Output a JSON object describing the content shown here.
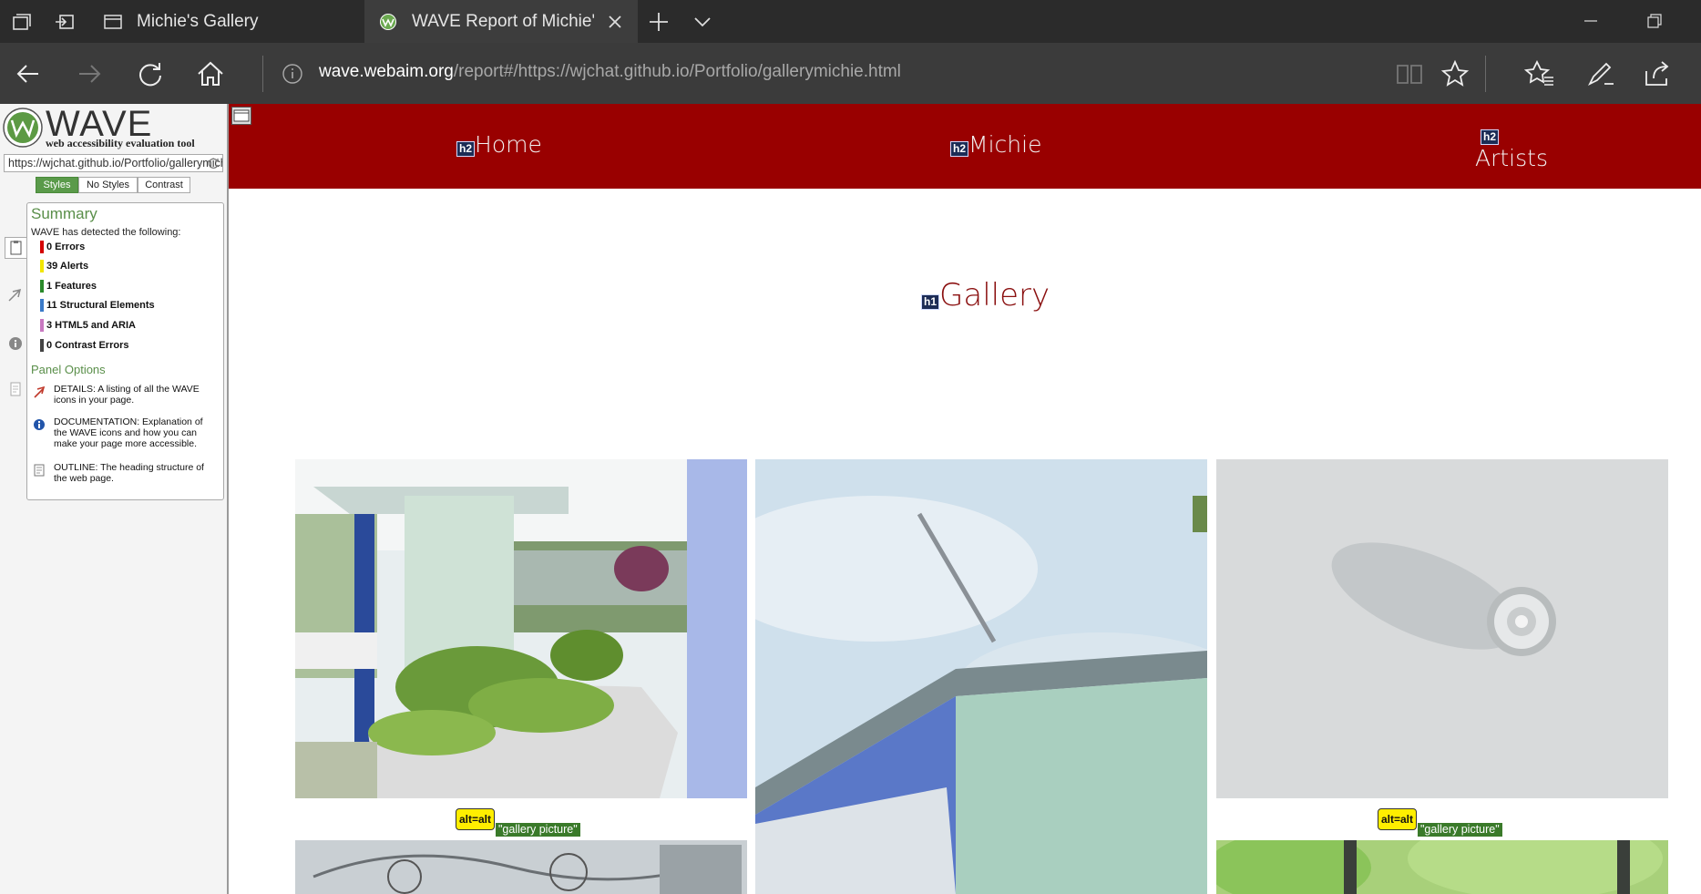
{
  "browser": {
    "tabs": [
      {
        "label": "Michie's Gallery",
        "active": false
      },
      {
        "label": "WAVE Report of Michie'",
        "active": true
      }
    ],
    "url_host": "wave.webaim.org",
    "url_path": "/report#/https://wjchat.github.io/Portfolio/gallerymichie.html"
  },
  "wave": {
    "title": "WAVE",
    "subtitle": "web accessibility evaluation tool",
    "url_field": "https://wjchat.github.io/Portfolio/gallerymichie.html",
    "modes": [
      "Styles",
      "No Styles",
      "Contrast"
    ],
    "summary": {
      "title": "Summary",
      "detected": "WAVE has detected the following:",
      "categories": [
        {
          "label": "0 Errors",
          "color": "#d40000"
        },
        {
          "label": "39 Alerts",
          "color": "#f2e600"
        },
        {
          "label": "1 Features",
          "color": "#2a8a2a"
        },
        {
          "label": "11 Structural Elements",
          "color": "#3a7ac8"
        },
        {
          "label": "3 HTML5 and ARIA",
          "color": "#c878c0"
        },
        {
          "label": "0 Contrast Errors",
          "color": "#444444"
        }
      ]
    },
    "panel_options": {
      "title": "Panel Options",
      "items": [
        {
          "icon": "flag-icon",
          "text": "DETAILS: A listing of all the WAVE icons in your page."
        },
        {
          "icon": "info-icon",
          "text": "DOCUMENTATION: Explanation of the WAVE icons and how you can make your page more accessible."
        },
        {
          "icon": "document-icon",
          "text": "OUTLINE: The heading structure of the web page."
        }
      ]
    }
  },
  "page": {
    "nav": [
      {
        "tag": "h2",
        "label": "Home"
      },
      {
        "tag": "h2",
        "label": "Michie"
      },
      {
        "tag": "h2",
        "label": "Artists"
      }
    ],
    "heading": {
      "tag": "h1",
      "label": "Gallery"
    },
    "images": [
      {
        "alt_badge": "alt=alt",
        "alt_text": "\"gallery picture\""
      },
      {
        "alt_badge": "alt=alt",
        "alt_text": "\"gallery picture\""
      }
    ],
    "colors": {
      "nav_bg": "#990000",
      "heading": "#8a0f0f"
    }
  }
}
